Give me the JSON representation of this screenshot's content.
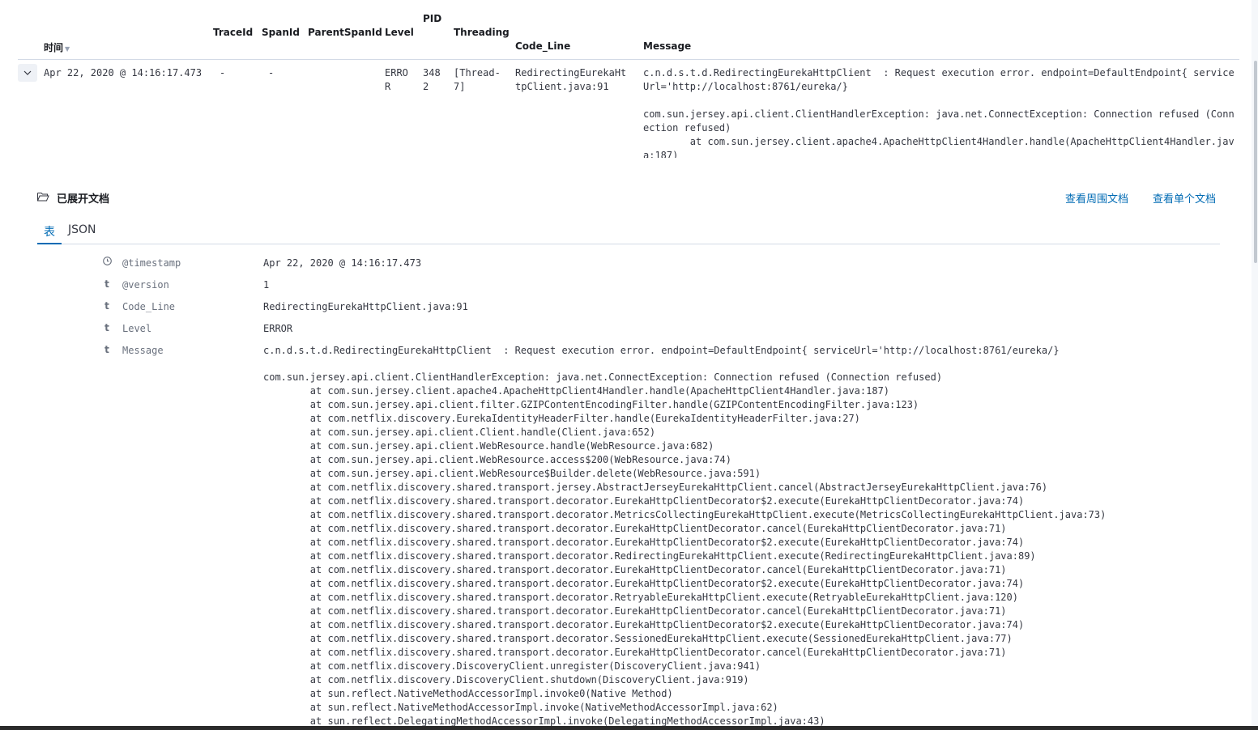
{
  "columns": {
    "time": "时间",
    "traceid": "TraceId",
    "spanid": "SpanId",
    "parentspanid": "ParentSpanId",
    "level": "Level",
    "pid": "PID",
    "threading": "Threading",
    "code_line": "Code_Line",
    "message": "Message"
  },
  "row": {
    "time": "Apr 22, 2020 @ 14:16:17.473",
    "traceid": "-",
    "spanid": "-",
    "level": "ERRO\nR",
    "pid": "348\n2",
    "threading": "[Thread-\n7]",
    "code_line": "RedirectingEurekaHt\ntpClient.java:91",
    "message": "c.n.d.s.t.d.RedirectingEurekaHttpClient  : Request execution error. endpoint=DefaultEndpoint{ serviceUrl='http://localhost:8761/eureka/}\n\ncom.sun.jersey.api.client.ClientHandlerException: java.net.ConnectException: Connection refused (Connection refused)\n\tat com.sun.jersey.client.apache4.ApacheHttpClient4Handler.handle(ApacheHttpClient4Handler.java:187)"
  },
  "expanded": {
    "title": "已展开文档",
    "link_surrounding": "查看周围文档",
    "link_single": "查看单个文档",
    "tab_table": "表",
    "tab_json": "JSON",
    "fields": [
      {
        "icon": "clock-icon",
        "type": "⏲",
        "name": "@timestamp",
        "value": "Apr 22, 2020 @ 14:16:17.473"
      },
      {
        "icon": "string-type-icon",
        "type": "t",
        "name": "@version",
        "value": "1"
      },
      {
        "icon": "string-type-icon",
        "type": "t",
        "name": "Code_Line",
        "value": "RedirectingEurekaHttpClient.java:91"
      },
      {
        "icon": "string-type-icon",
        "type": "t",
        "name": "Level",
        "value": "ERROR"
      },
      {
        "icon": "string-type-icon",
        "type": "t",
        "name": "Message",
        "value": "c.n.d.s.t.d.RedirectingEurekaHttpClient  : Request execution error. endpoint=DefaultEndpoint{ serviceUrl='http://localhost:8761/eureka/}"
      }
    ],
    "stack": [
      "com.sun.jersey.api.client.ClientHandlerException: java.net.ConnectException: Connection refused (Connection refused)",
      "\tat com.sun.jersey.client.apache4.ApacheHttpClient4Handler.handle(ApacheHttpClient4Handler.java:187)",
      "\tat com.sun.jersey.api.client.filter.GZIPContentEncodingFilter.handle(GZIPContentEncodingFilter.java:123)",
      "\tat com.netflix.discovery.EurekaIdentityHeaderFilter.handle(EurekaIdentityHeaderFilter.java:27)",
      "\tat com.sun.jersey.api.client.Client.handle(Client.java:652)",
      "\tat com.sun.jersey.api.client.WebResource.handle(WebResource.java:682)",
      "\tat com.sun.jersey.api.client.WebResource.access$200(WebResource.java:74)",
      "\tat com.sun.jersey.api.client.WebResource$Builder.delete(WebResource.java:591)",
      "\tat com.netflix.discovery.shared.transport.jersey.AbstractJerseyEurekaHttpClient.cancel(AbstractJerseyEurekaHttpClient.java:76)",
      "\tat com.netflix.discovery.shared.transport.decorator.EurekaHttpClientDecorator$2.execute(EurekaHttpClientDecorator.java:74)",
      "\tat com.netflix.discovery.shared.transport.decorator.MetricsCollectingEurekaHttpClient.execute(MetricsCollectingEurekaHttpClient.java:73)",
      "\tat com.netflix.discovery.shared.transport.decorator.EurekaHttpClientDecorator.cancel(EurekaHttpClientDecorator.java:71)",
      "\tat com.netflix.discovery.shared.transport.decorator.EurekaHttpClientDecorator$2.execute(EurekaHttpClientDecorator.java:74)",
      "\tat com.netflix.discovery.shared.transport.decorator.RedirectingEurekaHttpClient.execute(RedirectingEurekaHttpClient.java:89)",
      "\tat com.netflix.discovery.shared.transport.decorator.EurekaHttpClientDecorator.cancel(EurekaHttpClientDecorator.java:71)",
      "\tat com.netflix.discovery.shared.transport.decorator.EurekaHttpClientDecorator$2.execute(EurekaHttpClientDecorator.java:74)",
      "\tat com.netflix.discovery.shared.transport.decorator.RetryableEurekaHttpClient.execute(RetryableEurekaHttpClient.java:120)",
      "\tat com.netflix.discovery.shared.transport.decorator.EurekaHttpClientDecorator.cancel(EurekaHttpClientDecorator.java:71)",
      "\tat com.netflix.discovery.shared.transport.decorator.EurekaHttpClientDecorator$2.execute(EurekaHttpClientDecorator.java:74)",
      "\tat com.netflix.discovery.shared.transport.decorator.SessionedEurekaHttpClient.execute(SessionedEurekaHttpClient.java:77)",
      "\tat com.netflix.discovery.shared.transport.decorator.EurekaHttpClientDecorator.cancel(EurekaHttpClientDecorator.java:71)",
      "\tat com.netflix.discovery.DiscoveryClient.unregister(DiscoveryClient.java:941)",
      "\tat com.netflix.discovery.DiscoveryClient.shutdown(DiscoveryClient.java:919)",
      "\tat sun.reflect.NativeMethodAccessorImpl.invoke0(Native Method)",
      "\tat sun.reflect.NativeMethodAccessorImpl.invoke(NativeMethodAccessorImpl.java:62)",
      "\tat sun.reflect.DelegatingMethodAccessorImpl.invoke(DelegatingMethodAccessorImpl.java:43)"
    ]
  },
  "colors": {
    "link": "#006bb4",
    "border": "#d3dae6",
    "text": "#343741"
  }
}
